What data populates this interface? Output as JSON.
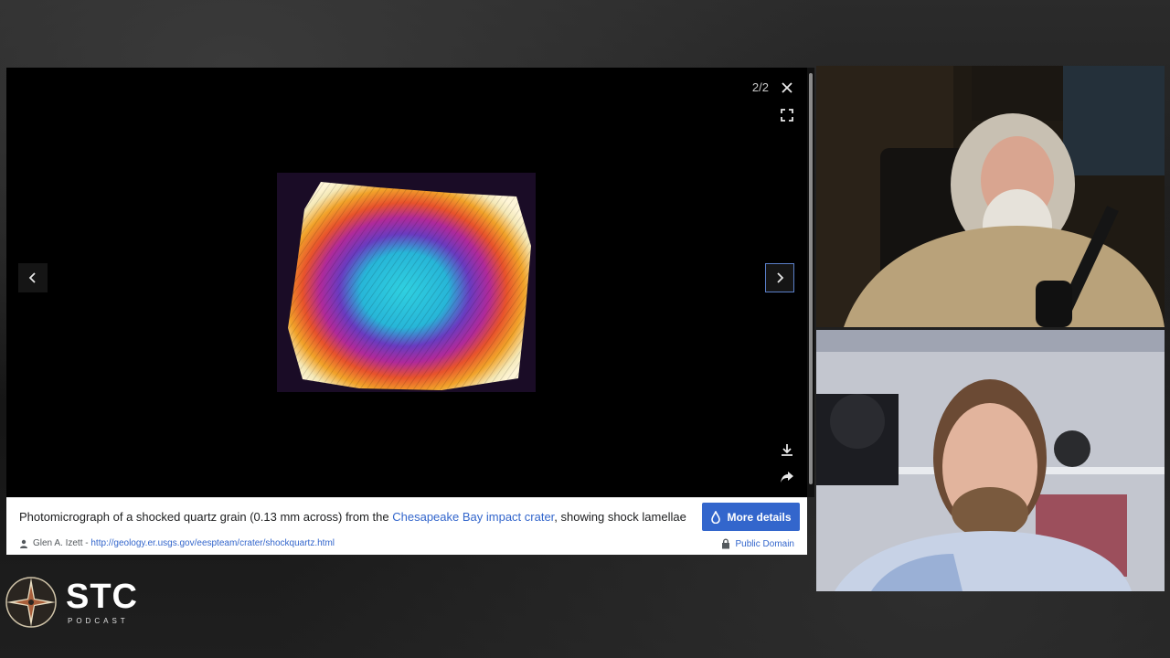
{
  "viewer": {
    "counter": "2/2",
    "icons": {
      "close": "close-icon",
      "fullscreen": "fullscreen-icon",
      "download": "download-icon",
      "share": "share-icon",
      "prev": "chevron-left-icon",
      "next": "chevron-right-icon"
    }
  },
  "caption": {
    "text_before": "Photomicrograph of a shocked quartz grain (0.13 mm across) from the ",
    "link_text": "Chesapeake Bay impact crater",
    "text_after": ", showing shock lamellae",
    "more_details_label": "More details",
    "author": "Glen A. Izett",
    "separator": " - ",
    "source_url": "http://geology.er.usgs.gov/eespteam/crater/shockquartz.html",
    "license": "Public Domain"
  },
  "logo": {
    "title": "STC",
    "subtitle": "PODCAST"
  },
  "colors": {
    "accent": "#3366cc",
    "link": "#3366cc",
    "viewer_bg": "#000000"
  }
}
